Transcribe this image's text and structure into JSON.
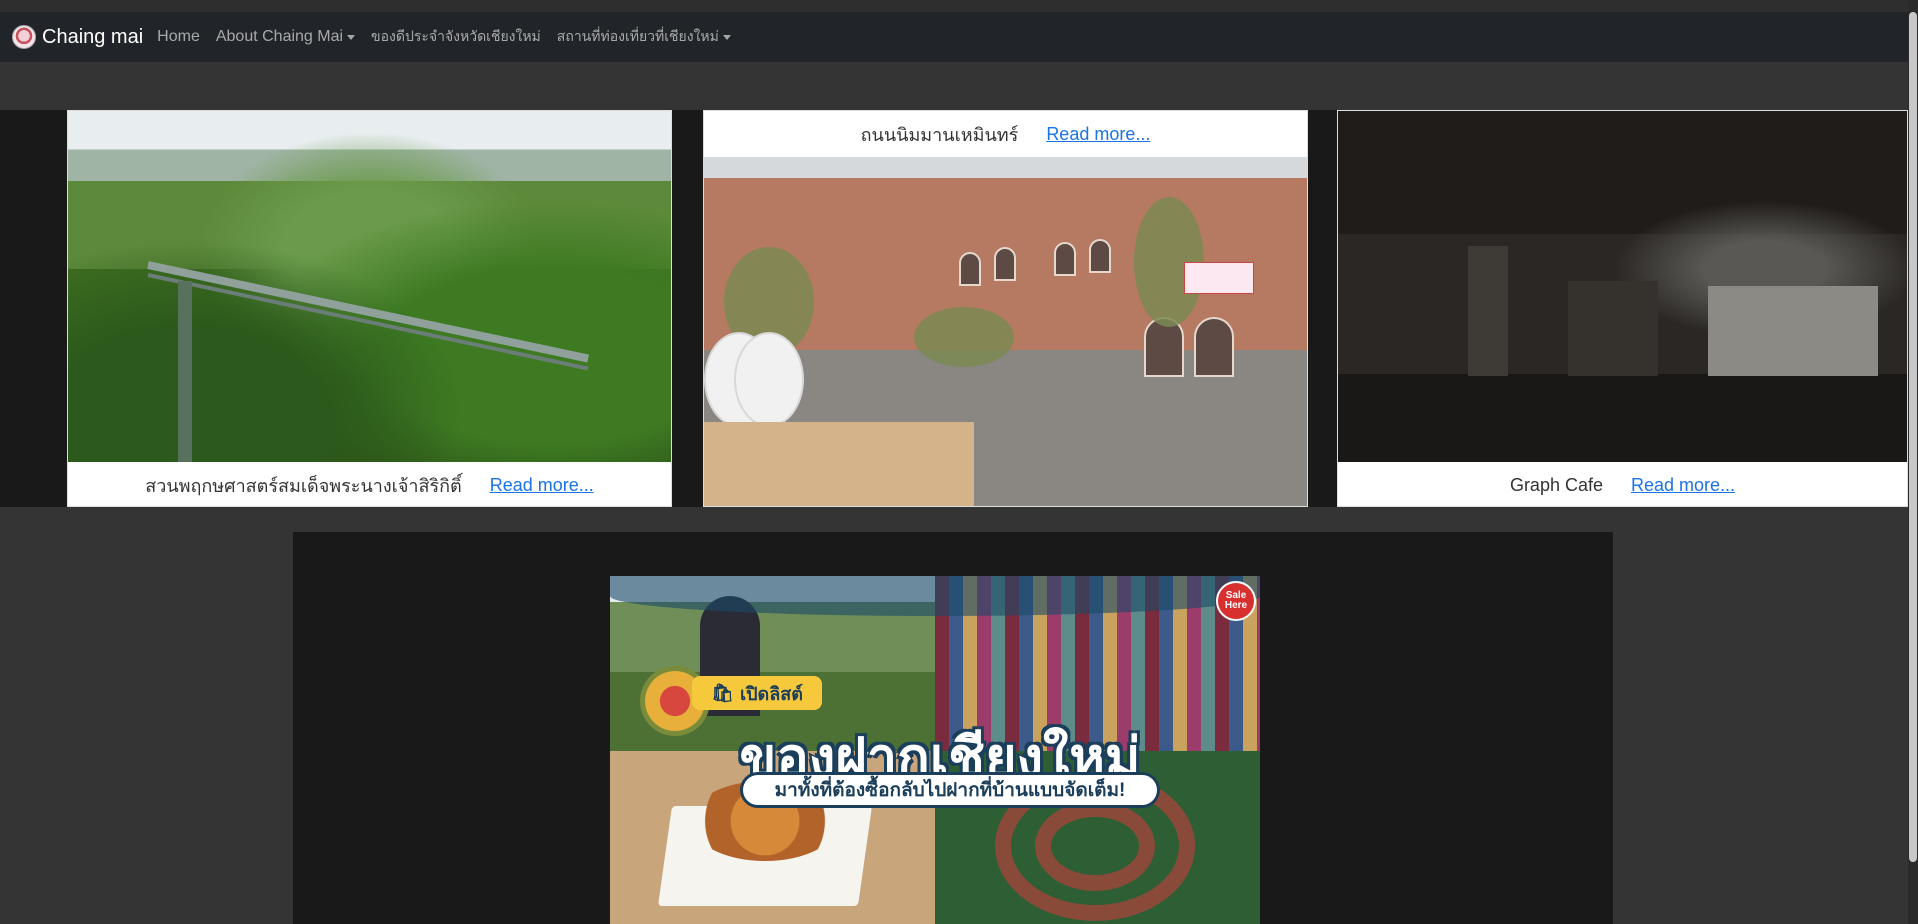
{
  "navbar": {
    "brand": "Chaing mai",
    "links": [
      {
        "label": "Home",
        "dropdown": false
      },
      {
        "label": "About Chaing Mai",
        "dropdown": true
      },
      {
        "label": "ของดีประจำจังหวัดเชียงใหม่",
        "dropdown": false
      },
      {
        "label": "สถานที่ท่องเที่ยวที่เชียงใหม่",
        "dropdown": true
      }
    ]
  },
  "carousel": {
    "cards": [
      {
        "caption": "สวนพฤกษศาสตร์สมเด็จพระนางเจ้าสิริกิติ์",
        "read_more": "Read more..."
      },
      {
        "caption": "ถนนนิมมานเหมินทร์",
        "read_more": "Read more..."
      },
      {
        "caption": "Graph Cafe",
        "read_more": "Read more..."
      }
    ]
  },
  "poster": {
    "badge": "เปิดลิสต์",
    "title": "ของฝากเชียงใหม่",
    "subtitle": "มาทั้งที่ต้องซื้อกลับไปฝากที่บ้านแบบจัดเต็ม!",
    "sale_tag": "Sale Here"
  },
  "colors": {
    "navbar_bg": "#212529",
    "link_color": "#1a73e8",
    "page_bg": "#343434"
  }
}
